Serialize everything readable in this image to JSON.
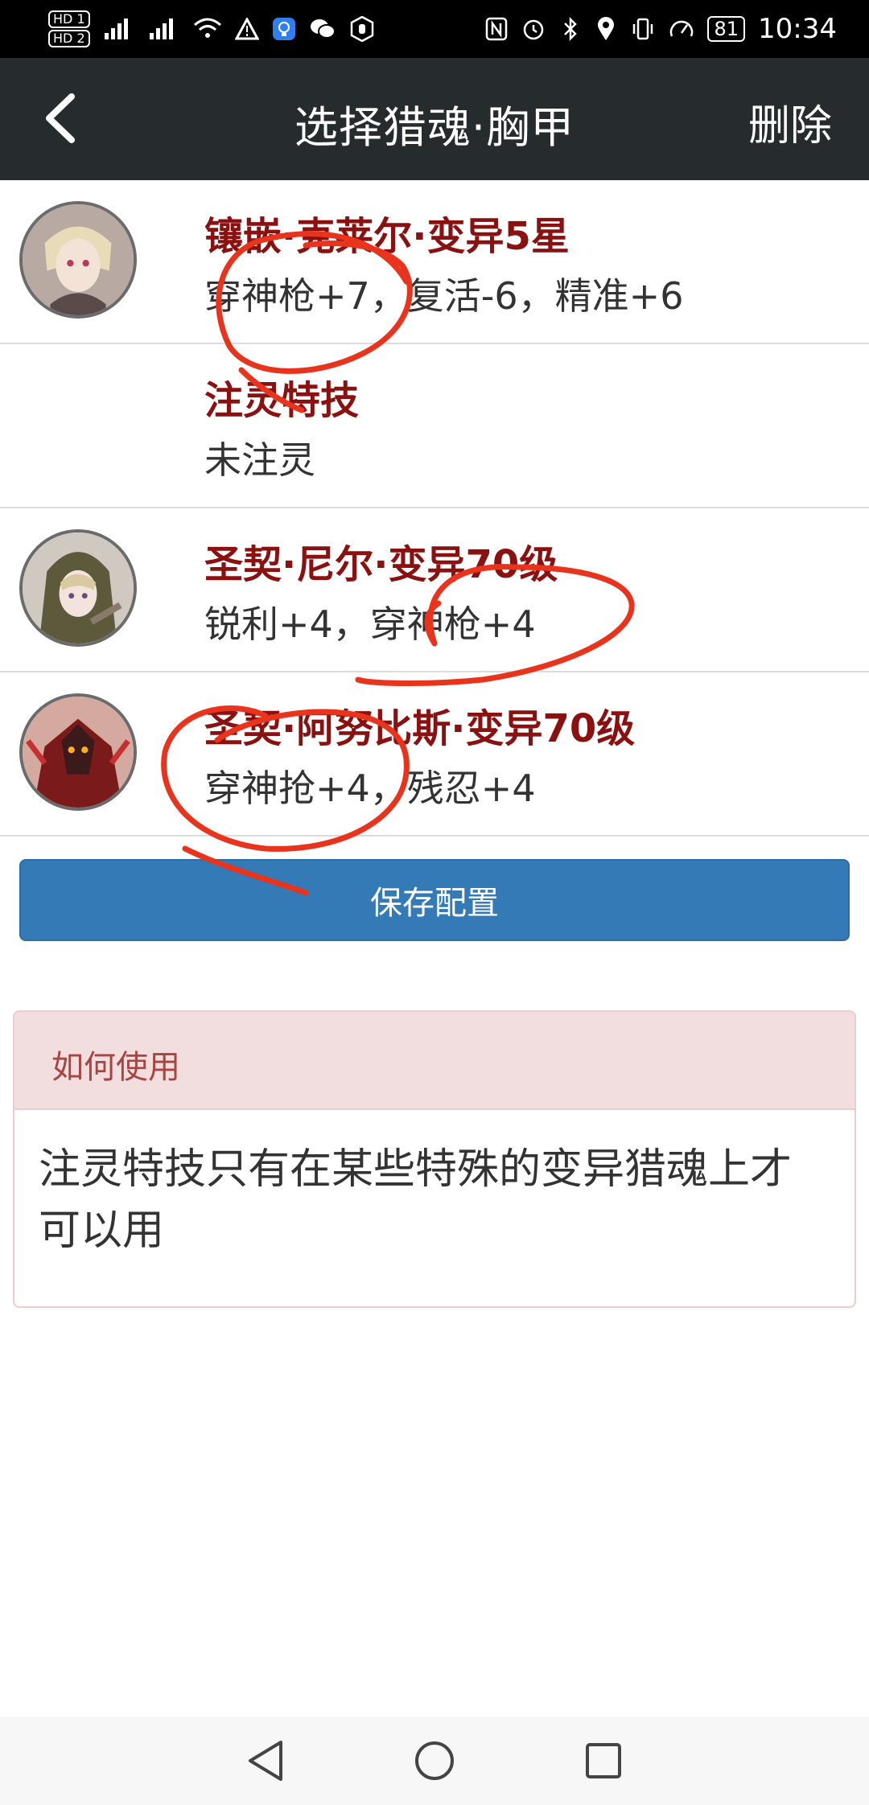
{
  "status_bar": {
    "left_icons": [
      "HD1/HD2",
      "4G signal-1",
      "4G signal-2",
      "wifi",
      "warning",
      "bulb-app",
      "wechat",
      "hand-app"
    ],
    "right_icons": [
      "nfc",
      "alarm",
      "bluetooth",
      "location",
      "vibrate",
      "speed"
    ],
    "battery": "81",
    "time": "10:34",
    "hd_top": "HD 1",
    "hd_bottom": "HD 2"
  },
  "header": {
    "title": "选择猎魂·胸甲",
    "action_label": "删除"
  },
  "items": [
    {
      "title": "镶嵌·克莱尔·变异5星",
      "stats": "穿神枪+7，复活-6，精准+6",
      "has_avatar": true
    },
    {
      "title": "注灵特技",
      "stats": "未注灵",
      "has_avatar": false
    },
    {
      "title": "圣契·尼尔·变异70级",
      "stats": "锐利+4，穿神枪+4",
      "has_avatar": true
    },
    {
      "title": "圣契·阿努比斯·变异70级",
      "stats": "穿神抢+4，残忍+4",
      "has_avatar": true
    }
  ],
  "save_button": "保存配置",
  "help_panel": {
    "heading": "如何使用",
    "body": "注灵特技只有在某些特殊的变异猎魂上才可以用"
  },
  "colors": {
    "nav_bg": "#262b2e",
    "title_red": "#8b1010",
    "save_blue": "#337ab7",
    "panel_head_bg": "#f2dede",
    "panel_head_text": "#a94442",
    "scribble": "#e8341c"
  }
}
